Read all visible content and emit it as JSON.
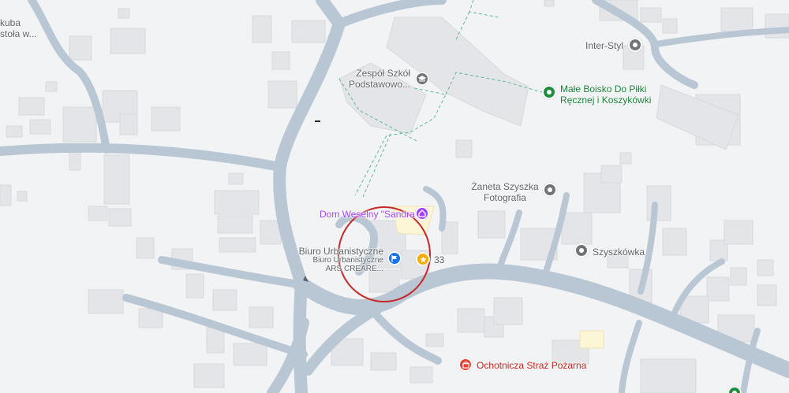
{
  "map": {
    "background": "#f1f3f4",
    "road_color": "#b9c6d3",
    "building_color": "#e3e5e8",
    "highlight_circle_color": "#c8282a",
    "labels": {
      "kuba": "kuba",
      "stola": "stoła w...",
      "inter_styl": "Inter-Styl",
      "zespol_line1": "Zespół Szkół",
      "zespol_line2": "Podstawowo...",
      "boisko_line1": "Małe Boisko Do Piłki",
      "boisko_line2": "Ręcznej i Koszykówki",
      "zaneta_line1": "Żaneta Szyszka",
      "zaneta_line2": "Fotografia",
      "dom_weselny": "Dom Weselny \"Sandra\"",
      "biuro_main": "Biuro Urbanistyczne",
      "biuro_sub1": "Biuro Urbanistyczne",
      "biuro_sub2": "ARS CREARE...",
      "number_33": "33",
      "szyszkowka": "Szyszkówka",
      "straz": "Ochotnicza Straż Pożarna"
    },
    "pins": {
      "inter_styl": {
        "icon": "gray-place-icon",
        "color": "#70757a"
      },
      "zespol": {
        "icon": "school-icon",
        "color": "#70757a"
      },
      "boisko": {
        "icon": "green-place-icon",
        "color": "#1e8e3e"
      },
      "zaneta": {
        "icon": "camera-place-icon",
        "color": "#70757a"
      },
      "dom_weselny": {
        "icon": "event-venue-icon",
        "color": "#a142f4"
      },
      "biuro": {
        "icon": "flag-icon",
        "color": "#1a73e8"
      },
      "star": {
        "icon": "star-icon",
        "color": "#f9ab00"
      },
      "szyszkowka": {
        "icon": "gray-place-icon",
        "color": "#70757a"
      },
      "straz": {
        "icon": "fire-station-icon",
        "color": "#e94235"
      },
      "edge": {
        "icon": "green-place-icon",
        "color": "#1e8e3e"
      }
    }
  }
}
